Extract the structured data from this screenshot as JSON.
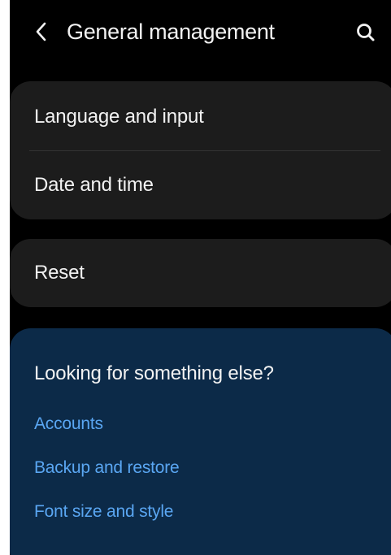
{
  "header": {
    "title": "General management",
    "back_icon": "chevron-left-icon",
    "search_icon": "search-icon"
  },
  "settings_groups": [
    {
      "items": [
        {
          "label": "Language and input"
        },
        {
          "label": "Date and time"
        }
      ]
    },
    {
      "items": [
        {
          "label": "Reset"
        }
      ]
    }
  ],
  "suggestions": {
    "title": "Looking for something else?",
    "links": [
      {
        "label": "Accounts"
      },
      {
        "label": "Backup and restore"
      },
      {
        "label": "Font size and style"
      }
    ]
  },
  "colors": {
    "background": "#000000",
    "card": "#1c1c1c",
    "suggestion_card": "#0c2a48",
    "link": "#5aa6f2",
    "text": "#f2f2f2"
  }
}
